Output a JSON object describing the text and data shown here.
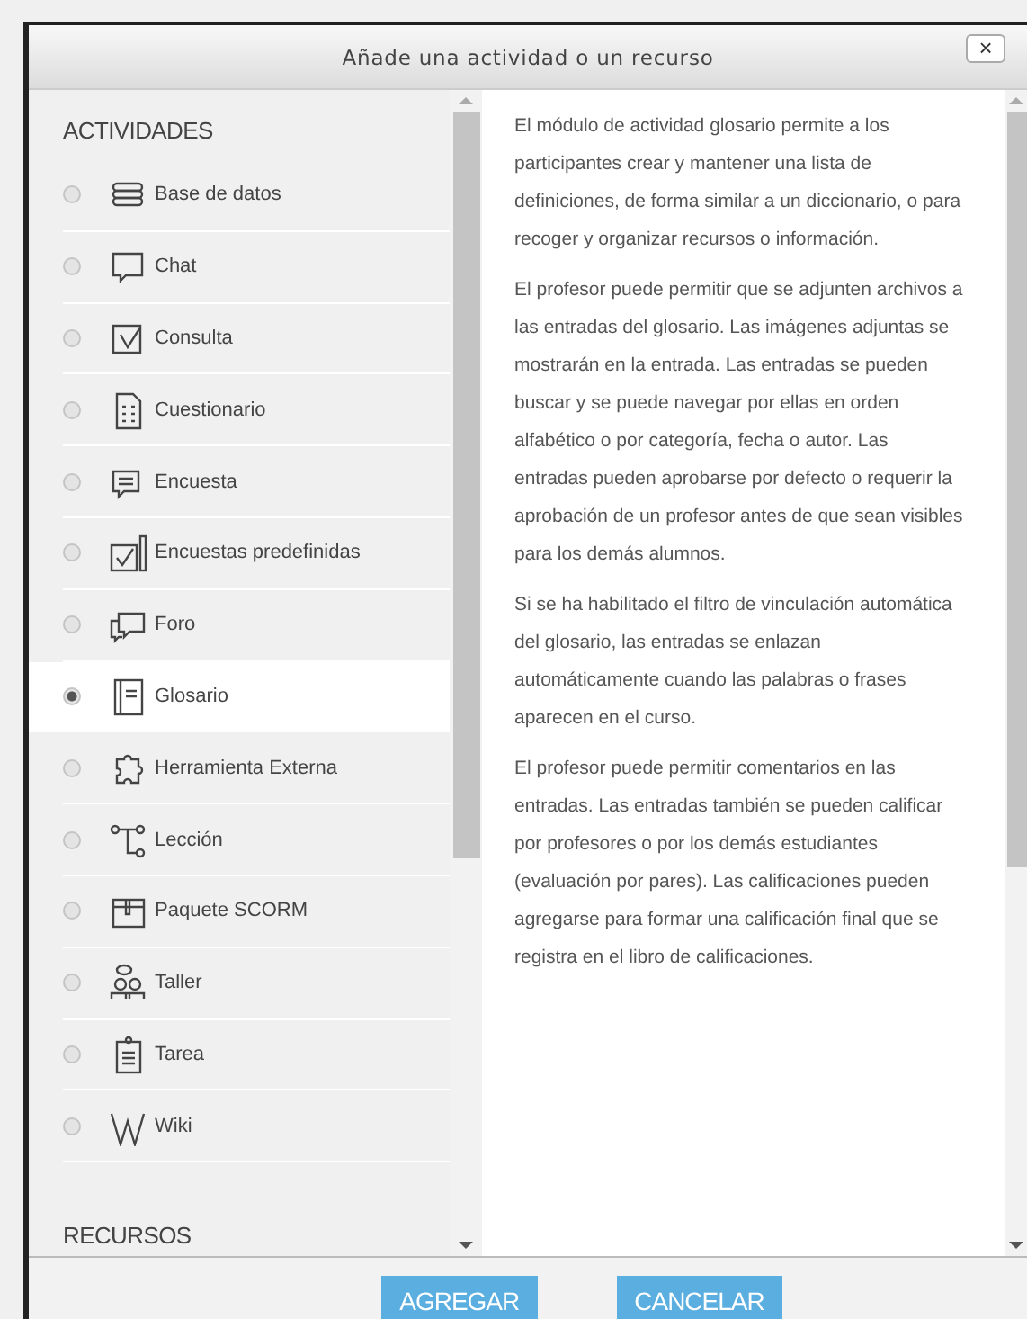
{
  "dialog": {
    "title": "Añade una actividad o un recurso",
    "close": "×"
  },
  "sections": [
    {
      "heading": "ACTIVIDADES"
    },
    {
      "heading": "RECURSOS"
    }
  ],
  "items": [
    {
      "label": "Base de datos",
      "selected": false
    },
    {
      "label": "Chat",
      "selected": false
    },
    {
      "label": "Consulta",
      "selected": false
    },
    {
      "label": "Cuestionario",
      "selected": false
    },
    {
      "label": "Encuesta",
      "selected": false
    },
    {
      "label": "Encuestas predefinidas",
      "selected": false
    },
    {
      "label": "Foro",
      "selected": false
    },
    {
      "label": "Glosario",
      "selected": true
    },
    {
      "label": "Herramienta Externa",
      "selected": false
    },
    {
      "label": "Lección",
      "selected": false
    },
    {
      "label": "Paquete SCORM",
      "selected": false
    },
    {
      "label": "Taller",
      "selected": false
    },
    {
      "label": "Tarea",
      "selected": false
    },
    {
      "label": "Wiki",
      "selected": false
    }
  ],
  "description": [
    "El módulo de actividad glosario permite a los participantes crear y mantener una lista de definiciones, de forma similar a un diccionario, o para recoger y organizar recursos o información.",
    "El profesor puede permitir que se adjunten archivos a las entradas del glosario. Las imágenes adjuntas se mostrarán en la entrada. Las entradas se pueden buscar y se puede navegar por ellas en orden alfabético o por categoría, fecha o autor. Las entradas pueden aprobarse por defecto o requerir la aprobación de un profesor antes de que sean visibles para los demás alumnos.",
    "Si se ha habilitado el filtro de vinculación automática del glosario, las entradas se enlazan automáticamente cuando las palabras o frases aparecen en el curso.",
    "El profesor puede permitir comentarios en las entradas. Las entradas también se pueden calificar por profesores o por los demás estudiantes (evaluación por pares). Las calificaciones pueden agregarse para formar una calificación final que se registra en el libro de calificaciones."
  ],
  "buttons": [
    "AGREGAR",
    "CANCELAR"
  ]
}
